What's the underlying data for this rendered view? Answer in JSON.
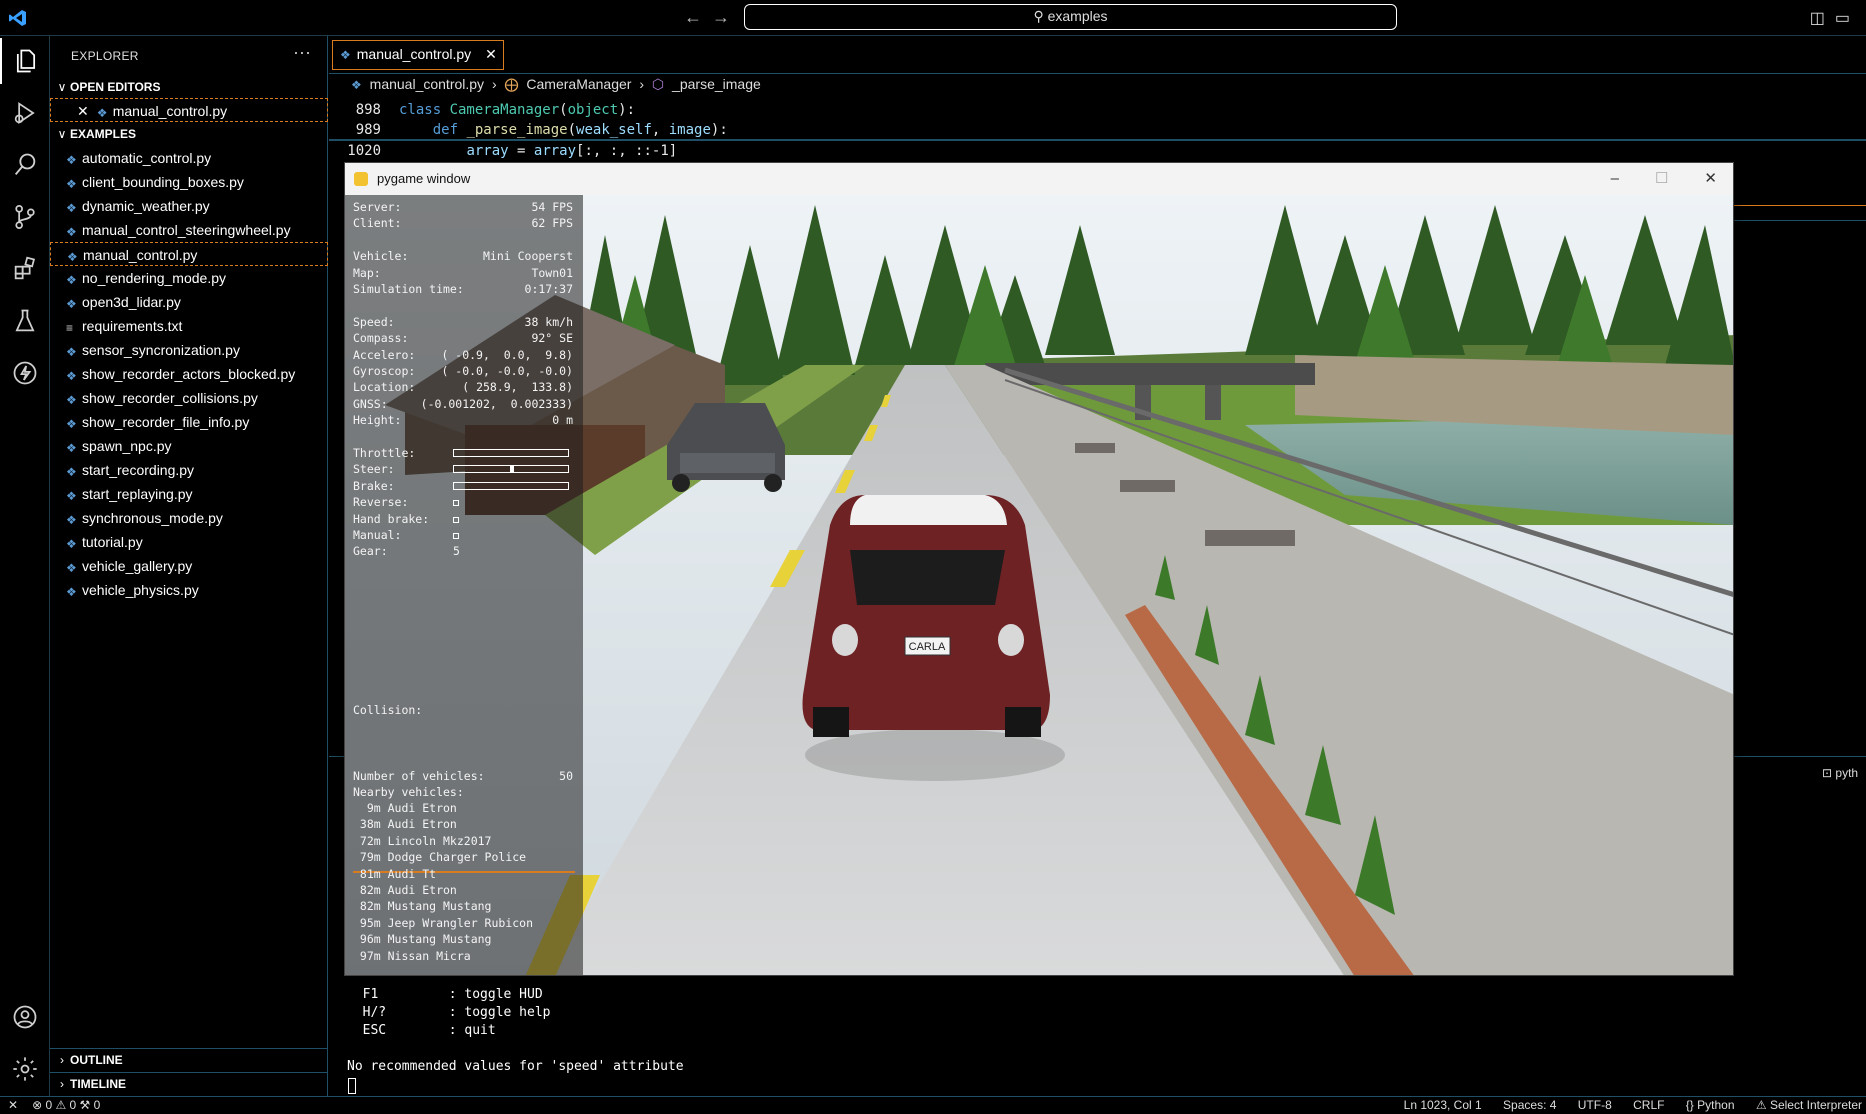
{
  "titlebar": {
    "search": "examples"
  },
  "sidebar": {
    "title": "EXPLORER",
    "more": "···",
    "open_editors_label": "OPEN EDITORS",
    "open_editor_file": "manual_control.py",
    "examples_label": "EXAMPLES",
    "files": [
      "automatic_control.py",
      "client_bounding_boxes.py",
      "dynamic_weather.py",
      "manual_control_steeringwheel.py",
      "manual_control.py",
      "no_rendering_mode.py",
      "open3d_lidar.py",
      "requirements.txt",
      "sensor_syncronization.py",
      "show_recorder_actors_blocked.py",
      "show_recorder_collisions.py",
      "show_recorder_file_info.py",
      "spawn_npc.py",
      "start_recording.py",
      "start_replaying.py",
      "synchronous_mode.py",
      "tutorial.py",
      "vehicle_gallery.py",
      "vehicle_physics.py"
    ],
    "outline_label": "OUTLINE",
    "timeline_label": "TIMELINE"
  },
  "editor": {
    "tab_label": "manual_control.py",
    "breadcrumb": {
      "file": "manual_control.py",
      "class": "CameraManager",
      "method": "_parse_image"
    },
    "sticky_lines": [
      {
        "num": "898",
        "indent": "",
        "parts": [
          [
            "kw",
            "class "
          ],
          [
            "cls",
            "CameraManager"
          ],
          [
            "plain",
            "("
          ],
          [
            "cls",
            "object"
          ],
          [
            "plain",
            "):"
          ]
        ]
      },
      {
        "num": "989",
        "indent": "    ",
        "parts": [
          [
            "kw",
            "def "
          ],
          [
            "fn",
            "_parse_image"
          ],
          [
            "plain",
            "("
          ],
          [
            "var",
            "weak_self"
          ],
          [
            "plain",
            ", "
          ],
          [
            "var",
            "image"
          ],
          [
            "plain",
            "):"
          ]
        ]
      },
      {
        "num": "1020",
        "indent": "        ",
        "parts": [
          [
            "var",
            "array"
          ],
          [
            "plain",
            " = "
          ],
          [
            "var",
            "array"
          ],
          [
            "plain",
            "[:, :, ::-1]"
          ]
        ]
      }
    ],
    "panel_tab": "pyth"
  },
  "terminal": {
    "lines": [
      "  F1         : toggle HUD",
      "  H/?        : toggle help",
      "  ESC        : quit",
      "",
      "No recommended values for 'speed' attribute"
    ]
  },
  "statusbar": {
    "left": "⊗ 0 ⚠ 0   ⚒ 0",
    "position": "Ln 1023, Col 1",
    "spaces": "Spaces: 4",
    "encoding": "UTF-8",
    "eol": "CRLF",
    "language": "{} Python",
    "interpreter": "⚠ Select Interpreter"
  },
  "pygame": {
    "title": "pygame window",
    "hud": {
      "rows": [
        {
          "k": "Server:",
          "v": "54 FPS"
        },
        {
          "k": "Client:",
          "v": "62 FPS"
        },
        {
          "k": "",
          "v": ""
        },
        {
          "k": "Vehicle:",
          "v": "Mini Cooperst"
        },
        {
          "k": "Map:",
          "v": "Town01"
        },
        {
          "k": "Simulation time:",
          "v": "0:17:37"
        },
        {
          "k": "",
          "v": ""
        },
        {
          "k": "Speed:",
          "v": "38 km/h"
        },
        {
          "k": "Compass:",
          "v": "92° SE"
        },
        {
          "k": "Accelero:",
          "v": "( -0.9,  0.0,  9.8)"
        },
        {
          "k": "Gyroscop:",
          "v": "( -0.0, -0.0, -0.0)"
        },
        {
          "k": "Location:",
          "v": "( 258.9,  133.8)"
        },
        {
          "k": "GNSS:",
          "v": "(-0.001202,  0.002333)"
        },
        {
          "k": "Height:",
          "v": "0 m"
        }
      ],
      "controls": [
        {
          "k": "Throttle:",
          "type": "bar",
          "value": 0.0
        },
        {
          "k": "Steer:",
          "type": "bar",
          "value": 0.5
        },
        {
          "k": "Brake:",
          "type": "bar",
          "value": 0.0
        },
        {
          "k": "Reverse:",
          "type": "check",
          "value": false
        },
        {
          "k": "Hand brake:",
          "type": "check",
          "value": false
        },
        {
          "k": "Manual:",
          "type": "check",
          "value": false
        },
        {
          "k": "Gear:",
          "type": "text",
          "value": "5"
        }
      ],
      "collision_label": "Collision:",
      "num_vehicles_label": "Number of vehicles:",
      "num_vehicles": "50",
      "nearby_label": "Nearby vehicles:",
      "nearby": [
        "  9m Audi Etron",
        " 38m Audi Etron",
        " 72m Lincoln Mkz2017",
        " 79m Dodge Charger Police",
        " 81m Audi Tt",
        " 82m Audi Etron",
        " 82m Mustang Mustang",
        " 95m Jeep Wrangler Rubicon",
        " 96m Mustang Mustang",
        " 97m Nissan Micra"
      ]
    },
    "plate": "CARLA"
  }
}
